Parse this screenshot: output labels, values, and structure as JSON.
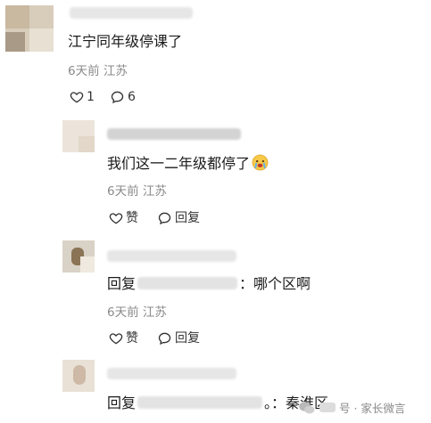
{
  "comments": [
    {
      "text": "江宁同年级停课了",
      "meta": "6天前 江苏",
      "like_count": "1",
      "reply_count": "6"
    },
    {
      "text": "我们这一二年级都停了",
      "meta": "6天前 江苏",
      "like_label": "赞",
      "reply_label": "回复"
    },
    {
      "reply_prefix": "回复",
      "text": "：哪个区啊",
      "meta": "6天前 江苏",
      "like_label": "赞",
      "reply_label": "回复"
    },
    {
      "reply_prefix": "回复",
      "text": "。：秦淮区"
    }
  ],
  "watermark": {
    "text": "号 · 家长微言"
  },
  "colors": {
    "text": "#1a1a1a",
    "meta": "#8a8a8a",
    "blur": "#e6e6e6"
  }
}
